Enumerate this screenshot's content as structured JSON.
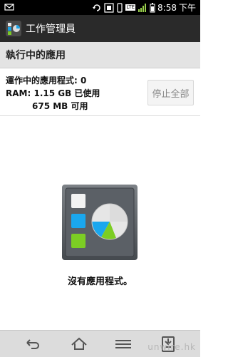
{
  "status": {
    "time": "8:58",
    "ampm": "下午",
    "network": "LTE"
  },
  "app": {
    "title": "工作管理員"
  },
  "section": {
    "title": "執行中的應用"
  },
  "summary": {
    "running_label": "運作中的應用程式:",
    "running_count": "0",
    "ram_label": "RAM:",
    "ram_used": "1.15 GB 已使用",
    "ram_free": "675 MB 可用"
  },
  "buttons": {
    "stop_all": "停止全部"
  },
  "empty": {
    "message": "沒有應用程式。"
  },
  "navigation": {
    "items": [
      "back-icon",
      "home-icon",
      "menu-icon",
      "recent-apps-icon"
    ]
  },
  "watermark": {
    "text": "unwire.hk"
  }
}
